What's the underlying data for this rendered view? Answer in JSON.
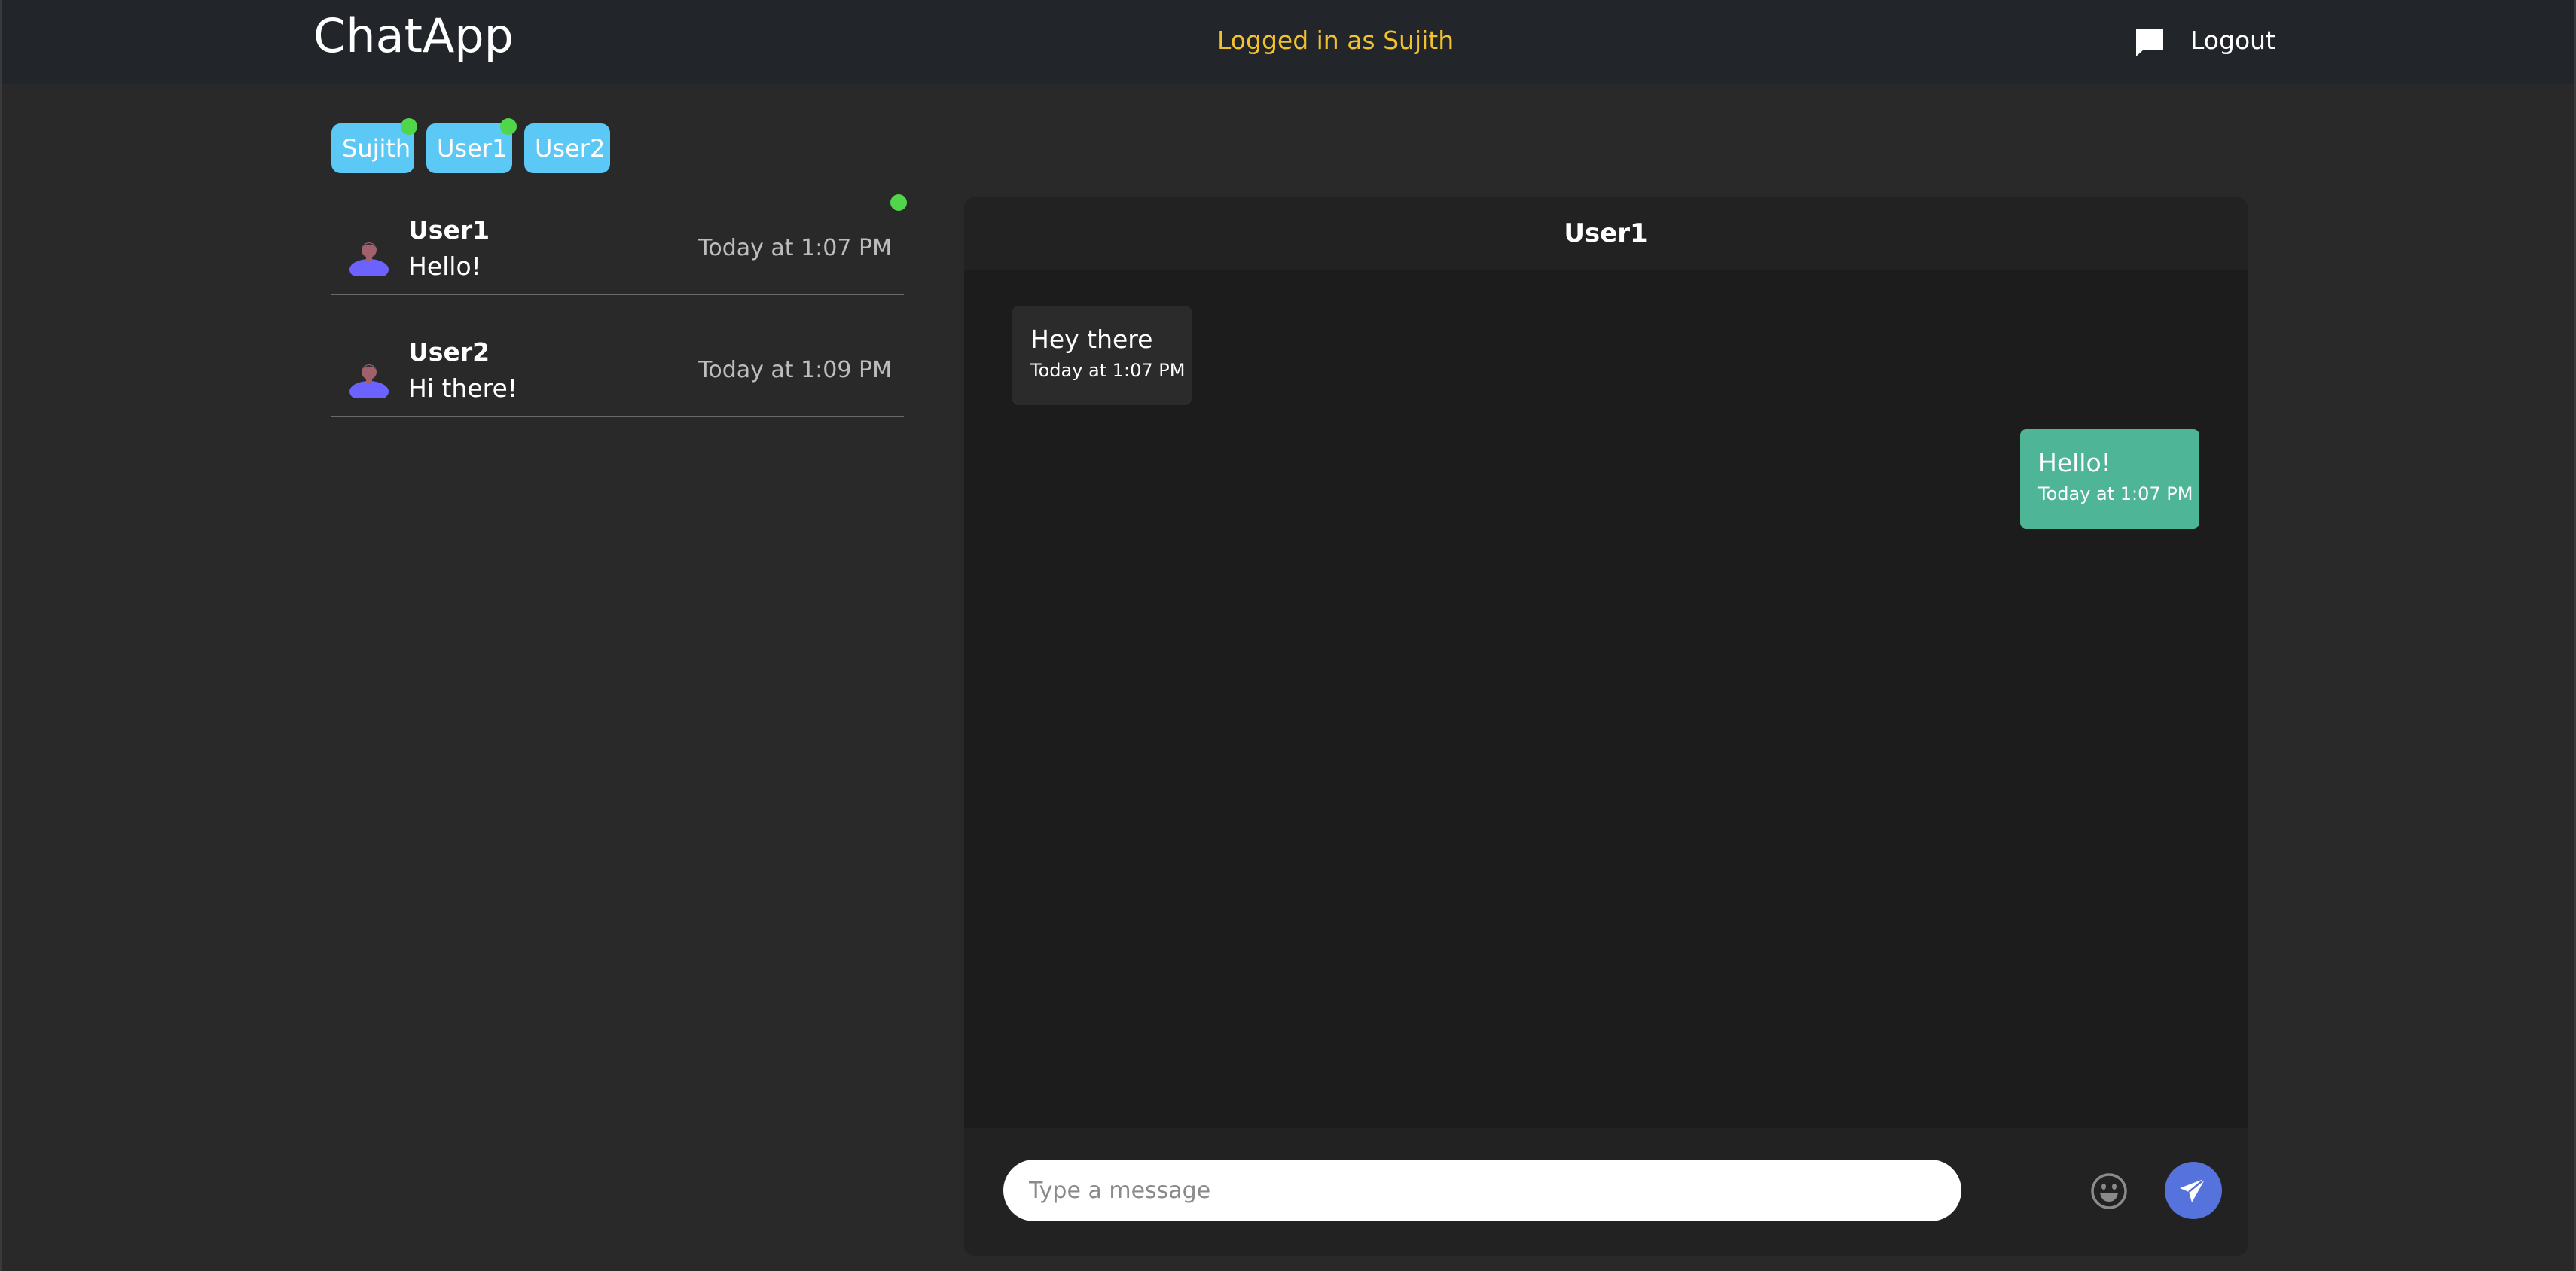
{
  "navbar": {
    "brand": "ChatApp",
    "status_text": "Logged in as Sujith",
    "chat_icon": "chat-bubble-icon",
    "logout_label": "Logout"
  },
  "online_users": [
    {
      "name": "Sujith",
      "online": true
    },
    {
      "name": "User1",
      "online": true
    },
    {
      "name": "User2",
      "online": false
    }
  ],
  "conversations": [
    {
      "name": "User1",
      "last_message": "Hello!",
      "time": "Today at 1:07 PM",
      "online": true
    },
    {
      "name": "User2",
      "last_message": "Hi there!",
      "time": "Today at 1:09 PM",
      "online": false
    }
  ],
  "chat": {
    "title": "User1",
    "messages": [
      {
        "direction": "incoming",
        "text": "Hey there",
        "time": "Today at 1:07 PM"
      },
      {
        "direction": "outgoing",
        "text": "Hello!",
        "time": "Today at 1:07 PM"
      }
    ],
    "input_placeholder": "Type a message",
    "input_value": "",
    "emoji_icon": "smiley-face-icon",
    "send_icon": "paper-plane-icon"
  },
  "colors": {
    "background": "#292929",
    "navbar": "#22252a",
    "status_text": "#f2c12e",
    "chip": "#5bc8f5",
    "online_dot": "#4fd64a",
    "incoming_bubble": "#2b2b2b",
    "outgoing_bubble": "#4fb597",
    "send_button": "#5672dc"
  }
}
